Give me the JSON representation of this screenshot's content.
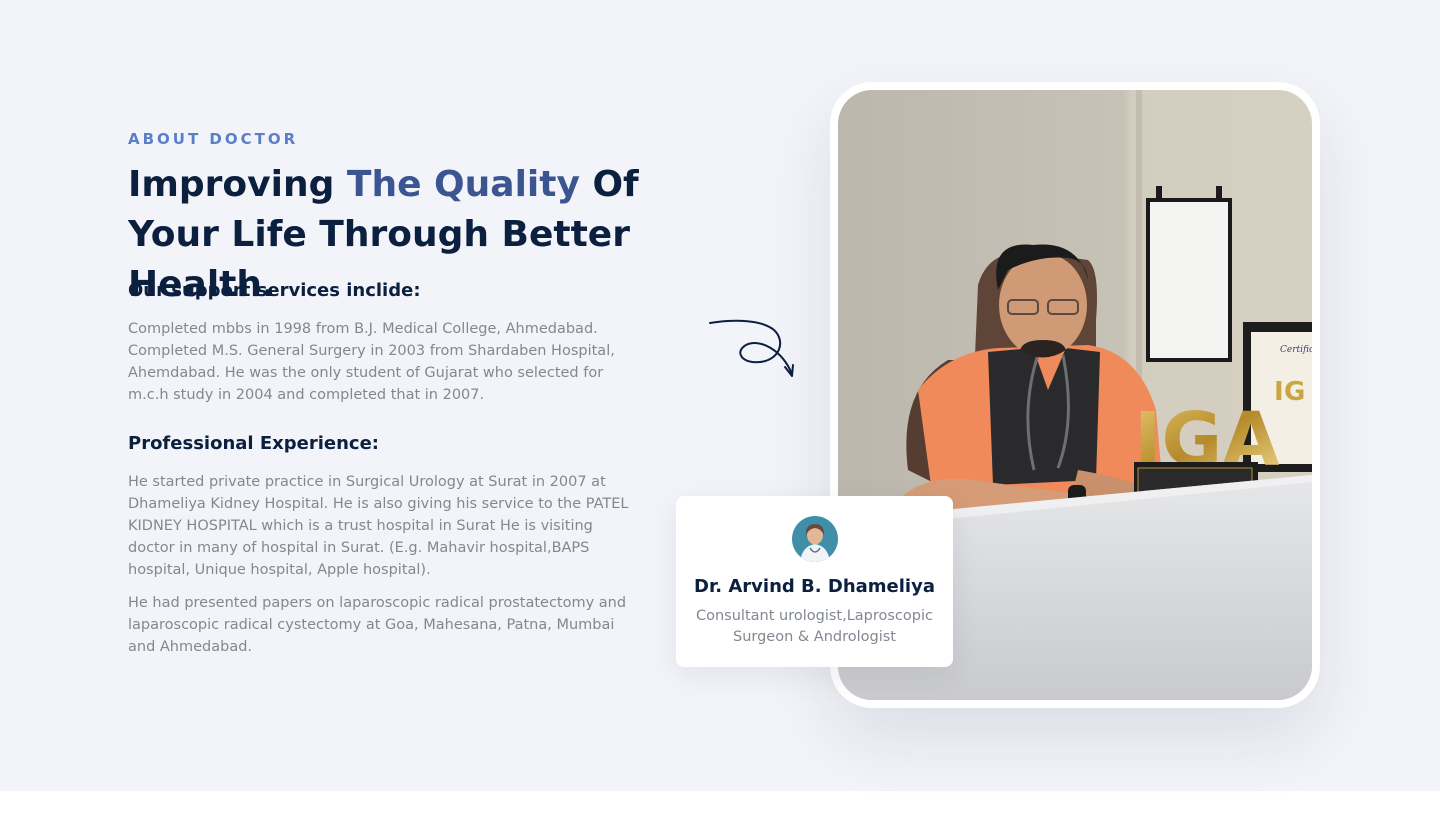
{
  "about": {
    "eyebrow": "ABOUT DOCTOR",
    "headline_part1": "Improving ",
    "headline_accent": "The Quality",
    "headline_part2": " Of Your Life Through Better Health."
  },
  "services": {
    "heading": "Our support services inclide:",
    "text": "Completed mbbs in 1998 from B.J. Medical College, Ahmedabad. Completed M.S. General Surgery in 2003 from Shardaben Hospital, Ahemdabad. He was the only student of Gujarat who selected for m.c.h study in 2004 and completed that in 2007."
  },
  "experience": {
    "heading": "Professional Experience:",
    "text1": "He started private practice in Surgical Urology at Surat in 2007 at Dhameliya Kidney Hospital. He is also giving his service to the PATEL KIDNEY HOSPITAL which is a trust hospital in Surat He is visiting doctor in many of hospital in Surat. (E.g. Mahavir hospital,BAPS hospital, Unique hospital, Apple hospital).",
    "text2": "He had presented papers on laparoscopic radical prostatectomy and laparoscopic radical cystectomy at Goa, Mahesana, Patna, Mumbai and Ahmedabad."
  },
  "doctor_card": {
    "name": "Dr. Arvind B. Dhameliya",
    "role": "Consultant urologist,Laproscopic Surgeon & Andrologist"
  },
  "photo": {
    "award_sign": "IGA",
    "certificate_title": "Certificate"
  },
  "colors": {
    "navy": "#0b1f3f",
    "accent": "#3b5591",
    "eyebrow": "#5b7ec9",
    "muted_text": "#828891",
    "section_bg": "#f3f4f9"
  }
}
